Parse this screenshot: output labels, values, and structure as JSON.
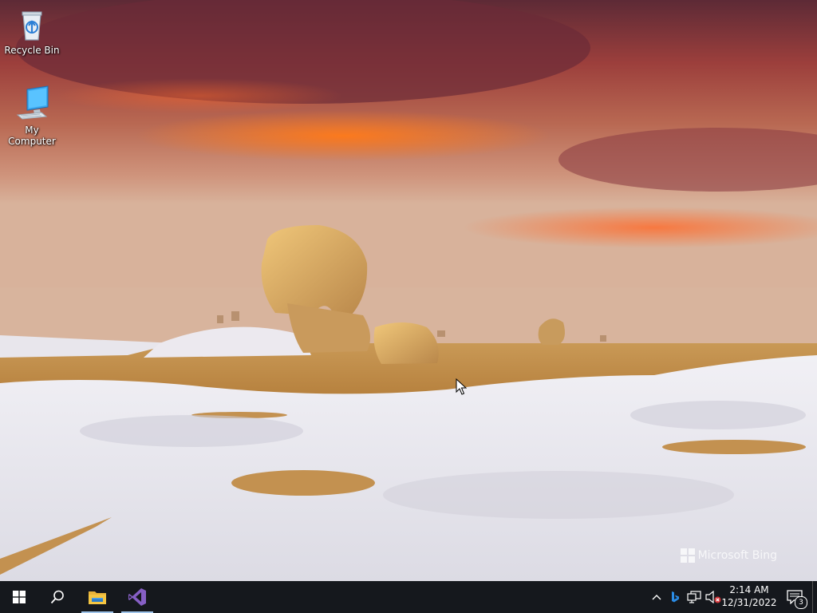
{
  "desktop": {
    "icons": [
      {
        "label": "Recycle Bin",
        "icon": "recycle-bin-icon"
      },
      {
        "label": "My Computer",
        "icon": "computer-icon"
      }
    ],
    "watermark": "Microsoft Bing"
  },
  "taskbar": {
    "pinned": [
      {
        "name": "start",
        "icon": "windows-logo-icon"
      },
      {
        "name": "search",
        "icon": "search-icon"
      },
      {
        "name": "file-explorer",
        "icon": "folder-icon"
      },
      {
        "name": "visual-studio",
        "icon": "visual-studio-icon"
      }
    ],
    "tray": {
      "icons": [
        "chevron-up-icon",
        "bing-icon",
        "network-icon",
        "volume-muted-icon"
      ],
      "time": "2:14 AM",
      "date": "12/31/2022",
      "notification_count": "3"
    }
  },
  "colors": {
    "taskbar_bg": "#15181d",
    "vs_purple": "#865fc5",
    "folder_yellow": "#f4c542",
    "windows_blue": "#ffffff"
  }
}
